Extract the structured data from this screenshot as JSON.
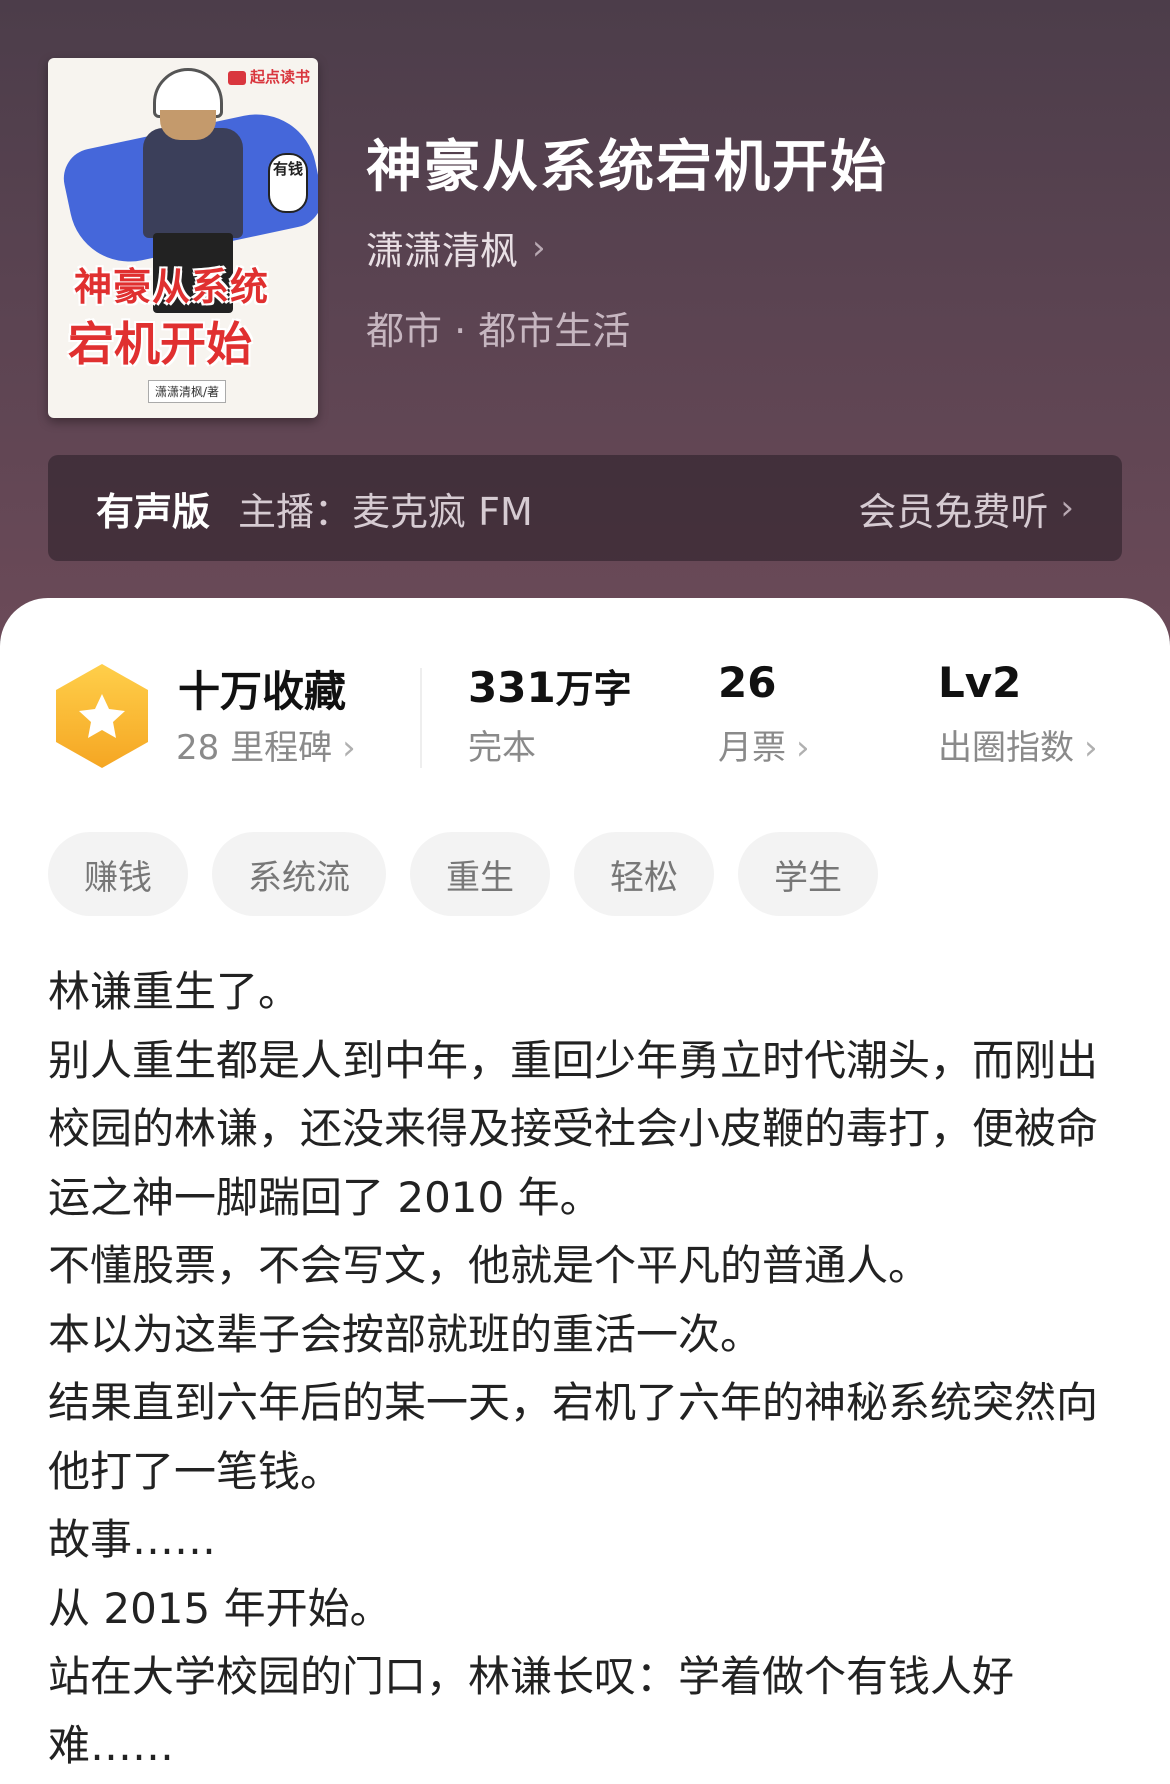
{
  "book": {
    "cover": {
      "brand": "起点读书",
      "badge": "有钱",
      "title_line1": "神豪从系统",
      "title_line2": "宕机开始",
      "byline": "潇潇清枫/著"
    },
    "title": "神豪从系统宕机开始",
    "author": "潇潇清枫",
    "genre": "都市 · 都市生活"
  },
  "audio": {
    "label": "有声版",
    "host": "主播：麦克疯 FM",
    "vip": "会员免费听"
  },
  "stats": {
    "favorites": "十万收藏",
    "milestone": "28 里程碑",
    "words_number": "331",
    "words_unit": "万字",
    "status": "完本",
    "monthly_votes": "26",
    "monthly_votes_label": "月票",
    "level": "Lv2",
    "level_label": "出圈指数"
  },
  "tags": [
    "赚钱",
    "系统流",
    "重生",
    "轻松",
    "学生"
  ],
  "synopsis": [
    "林谦重生了。",
    "别人重生都是人到中年，重回少年勇立时代潮头，而刚出校园的林谦，还没来得及接受社会小皮鞭的毒打，便被命运之神一脚踹回了 2010 年。",
    "不懂股票，不会写文，他就是个平凡的普通人。",
    "本以为这辈子会按部就班的重活一次。",
    "结果直到六年后的某一天，宕机了六年的神秘系统突然向他打了一笔钱。",
    "故事……",
    "从 2015 年开始。",
    "站在大学校园的门口，林谦长叹：学着做个有钱人好难……"
  ],
  "colors": {
    "header_bg": "#5a4351",
    "badge_gold": "#f6b93b",
    "cover_title_red": "#e03030"
  },
  "icons": {
    "rank_badge": "star-hexagon-icon",
    "chevron": "chevron-right-icon"
  }
}
